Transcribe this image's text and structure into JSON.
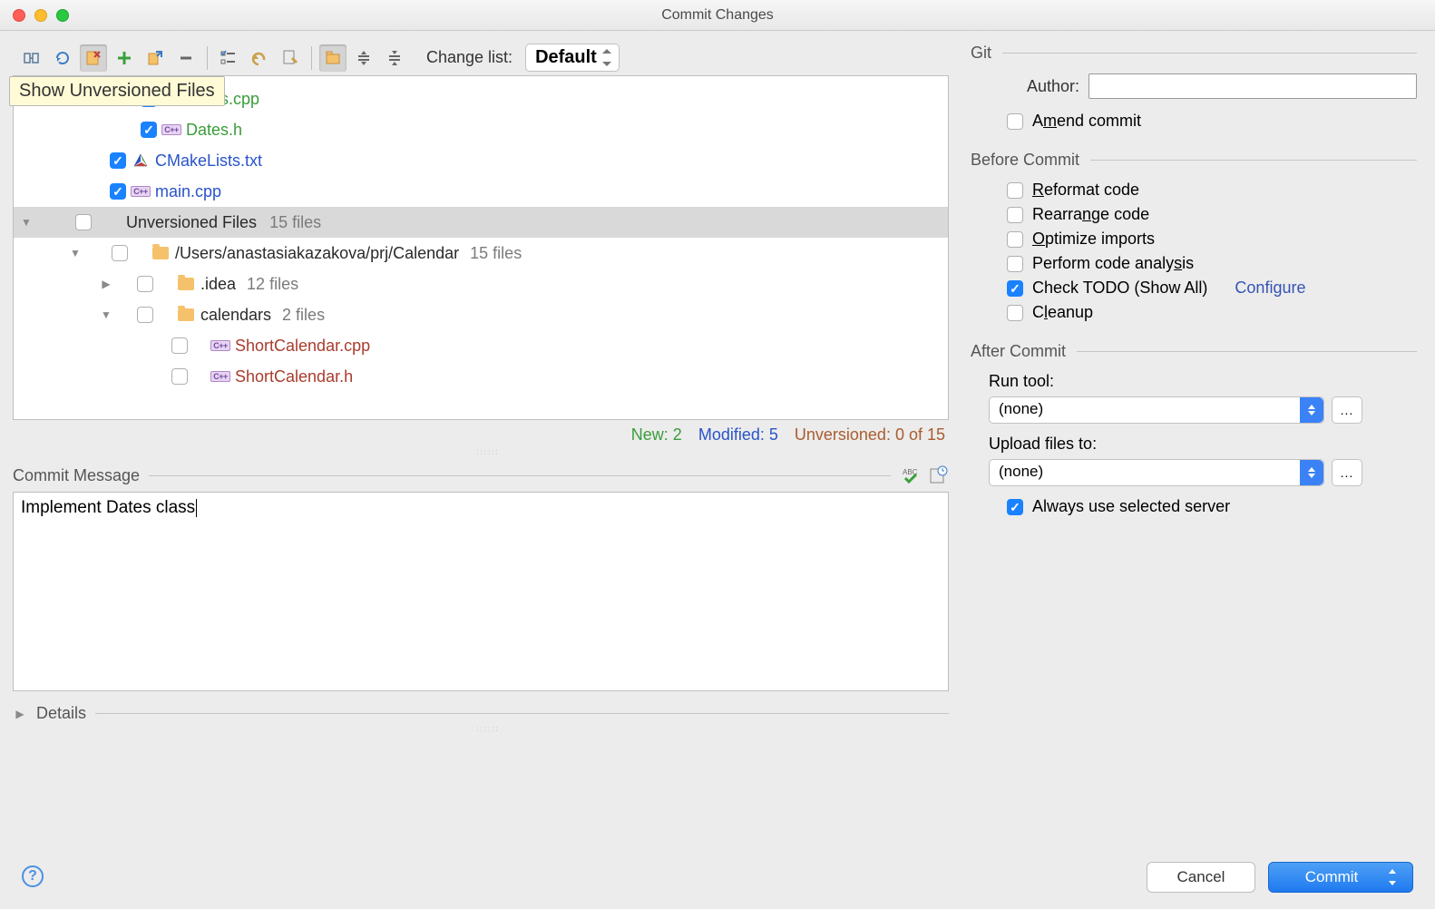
{
  "title": "Commit Changes",
  "tooltip": "Show Unversioned Files",
  "changelist_label": "Change list:",
  "changelist_value": "Default",
  "tree": {
    "dates_cpp": "Dates.cpp",
    "dates_h": "Dates.h",
    "cmake": "CMakeLists.txt",
    "main": "main.cpp",
    "unversioned_label": "Unversioned Files",
    "unversioned_count": "15 files",
    "path": "/Users/anastasiakazakova/prj/Calendar",
    "path_count": "15 files",
    "idea": ".idea",
    "idea_count": "12 files",
    "calendars": "calendars",
    "calendars_count": "2 files",
    "sc_cpp": "ShortCalendar.cpp",
    "sc_h": "ShortCalendar.h"
  },
  "stats": {
    "new": "New: 2",
    "modified": "Modified: 5",
    "unversioned": "Unversioned: 0 of 15"
  },
  "commit_message_label": "Commit Message",
  "commit_message": "Implement Dates class",
  "details_label": "Details",
  "git": {
    "title": "Git",
    "author_label": "Author:",
    "author_value": "",
    "amend": "Amend commit"
  },
  "before": {
    "title": "Before Commit",
    "reformat": "Reformat code",
    "rearrange": "Rearrange code",
    "optimize": "Optimize imports",
    "analysis": "Perform code analysis",
    "todo": "Check TODO (Show All)",
    "configure": "Configure",
    "cleanup": "Cleanup"
  },
  "after": {
    "title": "After Commit",
    "run_tool_label": "Run tool:",
    "run_tool_value": "(none)",
    "upload_label": "Upload files to:",
    "upload_value": "(none)",
    "always": "Always use selected server"
  },
  "buttons": {
    "cancel": "Cancel",
    "commit": "Commit"
  }
}
